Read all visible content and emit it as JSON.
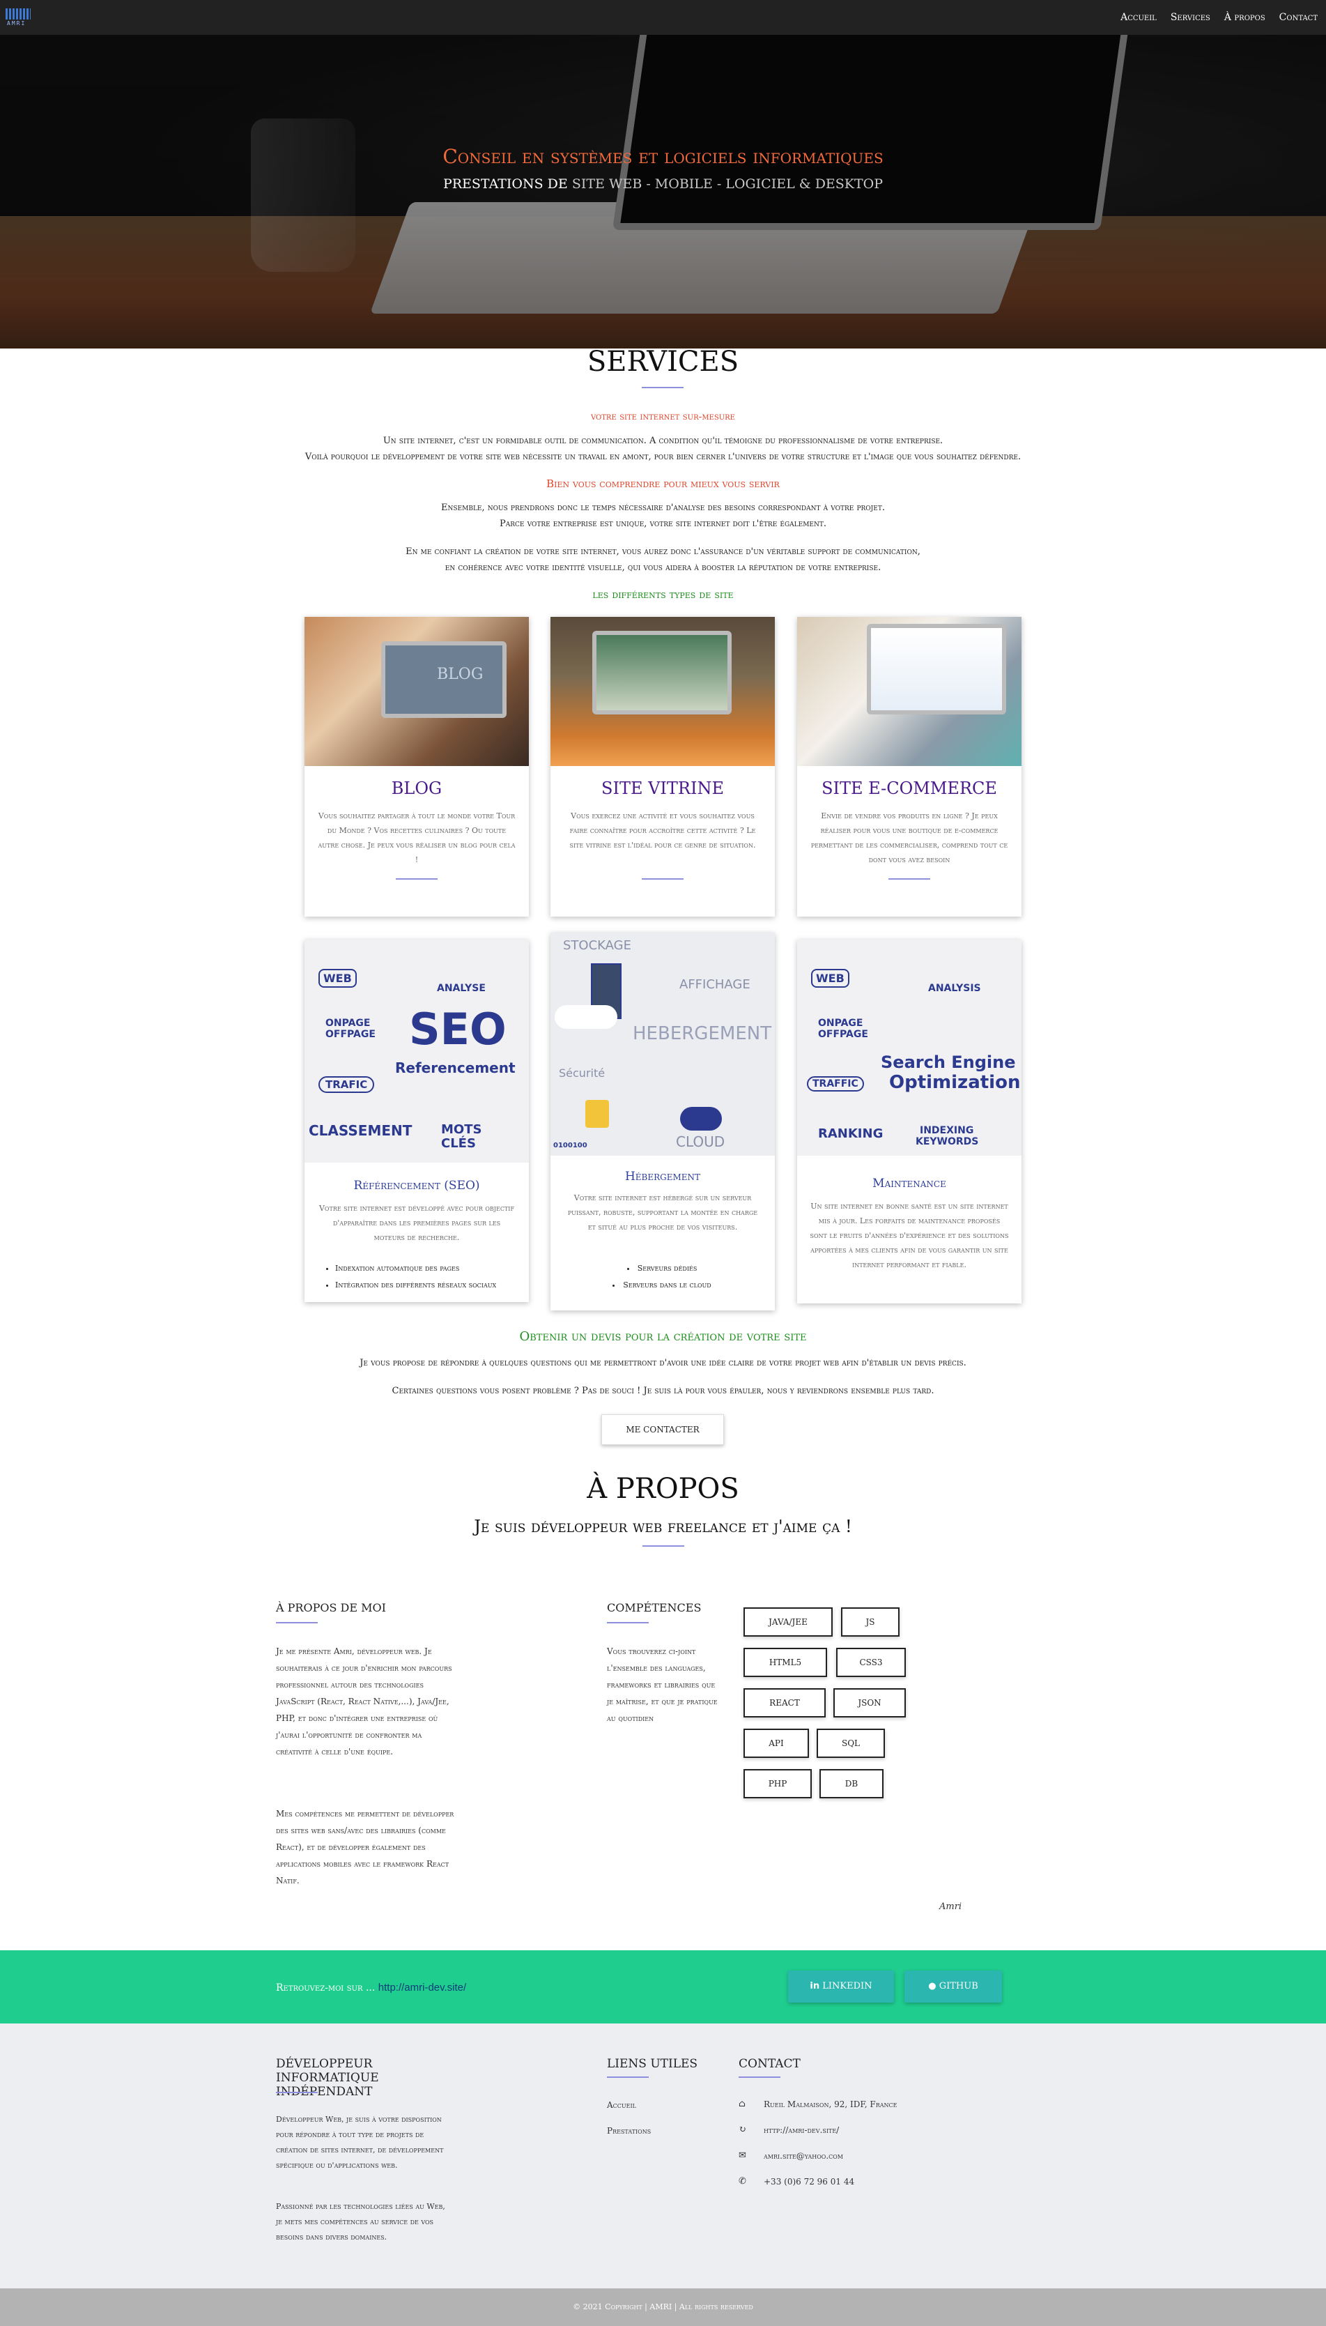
{
  "brand": {
    "logo_text": "AMRI"
  },
  "nav": {
    "items": [
      "Accueil",
      "Services",
      "À propos",
      "Contact"
    ]
  },
  "hero": {
    "title": "Conseil en systèmes et logiciels informatiques",
    "subtitle_prefix": "PRESTATIONS DE",
    "subtitle_rest": "SITE WEB - MOBILE - LOGICIEL & DESKTOP"
  },
  "services": {
    "title": "SERVICES",
    "h1": "votre site internet sur-mesure",
    "p1": "Un site internet, c'est un formidable outil de communication. A condition qu'il témoigne du professionnalisme de votre entreprise.",
    "p2": "Voilà pourquoi le développement de votre site web nécessite un travail en amont, pour bien cerner l'univers de votre structure et l'image que vous souhaitez défendre.",
    "h2": "Bien vous comprendre pour mieux vous servir",
    "p3": "Ensemble, nous prendrons donc le temps nécessaire d'analyse des besoins correspondant à votre projet.",
    "p4": "Parce votre entreprise est unique, votre site internet doit l'être également.",
    "p5": "En me confiant la création de votre site internet, vous aurez donc l'assurance d'un véritable support de communication,",
    "p6": "en cohérence avec votre identité visuelle, qui vous aidera à booster la réputation de votre entreprise.",
    "types_title": "les différents types de site",
    "cards": [
      {
        "title": "BLOG",
        "text": "Vous souhaitez partager à tout le monde votre Tour du Monde ? Vos recettes culinaires ? Ou toute autre chose. Je peux vous réaliser un blog pour cela !",
        "img_word": "BLOG"
      },
      {
        "title": "SITE VITRINE",
        "text": "Vous exercez une activité et vous souhaitez vous faire connaître pour accroître cette activité ? Le site vitrine est l'idéal pour ce genre de situation."
      },
      {
        "title": "SITE E-COMMERCE",
        "text": "Envie de vendre vos produits en ligne ? Je peux réaliser pour vous une boutique de e-commerce permettant de les commercialiser, comprend tout ce dont vous avez besoin"
      }
    ],
    "cards2": [
      {
        "title": "Référencement (SEO)",
        "text": "Votre site internet est développé avec pour objectif d'apparaître dans les premières pages sur les moteurs de recherche.",
        "bullets": [
          "Indexation automatique des pages",
          "Intégration des différents réseaux sociaux"
        ],
        "img_words": [
          "WEB",
          "ANALYSE",
          "ONPAGE",
          "OFFPAGE",
          "SEO",
          "Referencement",
          "TRAFIC",
          "CLASSEMENT",
          "MOTS",
          "CLÉS"
        ]
      },
      {
        "title": "Hébergement",
        "text": "Votre site internet est hébergé sur un serveur puissant, robuste, supportant la montée en charge et situé au plus proche de vos visiteurs.",
        "bullets": [
          "Serveurs dédiés",
          "Serveurs dans le cloud"
        ],
        "img_words": [
          "STOCKAGE",
          "AFFICHAGE",
          "HEBERGEMENT",
          "Sécurité",
          "CLOUD",
          "0100100"
        ]
      },
      {
        "title": "Maintenance",
        "text": "Un site internet en bonne santé est un site internet mis à jour. Les forfaits de maintenance proposés sont le fruits d'années d'expérience et des solutions apportées à mes clients afin de vous garantir un site internet performant et fiable.",
        "img_words": [
          "WEB",
          "ANALYSIS",
          "ONPAGE",
          "OFFPAGE",
          "Search Engine",
          "Optimization",
          "TRAFFIC",
          "RANKING",
          "INDEXING",
          "KEYWORDS"
        ]
      }
    ],
    "devis_title": "Obtenir un devis pour la création de votre site",
    "devis_p1": "Je vous propose de répondre à quelques questions qui me permettront d'avoir une idée claire de votre projet web afin d'établir un devis précis.",
    "devis_p2": "Certaines questions vous posent problème ? Pas de souci ! Je suis là pour vous épauler, nous y reviendrons ensemble plus tard.",
    "contact_button": "ME CONTACTER"
  },
  "about": {
    "title": "À PROPOS",
    "subtitle": "Je suis développeur web freelance et j'aime ça !",
    "me_heading": "À PROPOS DE MOI",
    "me_p1": "Je me présente Amri, développeur web. Je souhaiterais à ce jour d'enrichir mon parcours professionnel autour des technologies JavaScript (React, React Native,...), Java/Jee, PHP, et donc d'intégrer une entreprise où j'aurai l'opportunité de confronter ma créativité à celle d'une équipe.",
    "me_p2": "Mes compétences me permettent de développer des sites web sans/avec des librairies (comme React), et de développer également des applications mobiles avec le framework React Natif.",
    "skills_heading": "COMPÉTENCES",
    "skills_p": "Vous trouverez ci-joint l'ensemble des languages, frameworks et librairies que je maîtrise, et que je pratique au quotidien",
    "skills": [
      "JAVA/JEE",
      "JS",
      "HTML5",
      "CSS3",
      "REACT",
      "JSON",
      "API",
      "SQL",
      "PHP",
      "DB"
    ],
    "signature": "Amri"
  },
  "social": {
    "text": "Retrouvez-moi sur ...",
    "link": "http://amri-dev.site/",
    "linkedin": "LINKEDIN",
    "github": "GITHUB"
  },
  "footer": {
    "col1_heading": "DÉVELOPPEUR INFORMATIQUE INDÉPENDANT",
    "col1_p1": "Développeur Web, je suis à votre disposition pour répondre à tout type de projets de création de sites internet, de développement spécifique ou d'applications web.",
    "col1_p2": "Passionné par les technologies liées au Web, je mets mes compétences au service de vos besoins dans divers domaines.",
    "col2_heading": "LIENS UTILES",
    "links": [
      "Accueil",
      "Prestations"
    ],
    "col3_heading": "CONTACT",
    "contacts": [
      {
        "icon": "home-icon",
        "text": "Rueil Malmaison, 92, IDF, France"
      },
      {
        "icon": "refresh-icon",
        "text": "http://amri-dev.site/"
      },
      {
        "icon": "envelope-icon",
        "text": "amri.site@yahoo.com"
      },
      {
        "icon": "phone-icon",
        "text": "+33 (0)6 72 96 01 44"
      }
    ]
  },
  "copyright": "© 2021 Copyright | AMRI | All rights reserved",
  "colors": {
    "accent_orange": "#f16a3c",
    "accent_green": "#1fce8f",
    "accent_purple": "#4a1a8a",
    "nav_bg": "#222222"
  }
}
